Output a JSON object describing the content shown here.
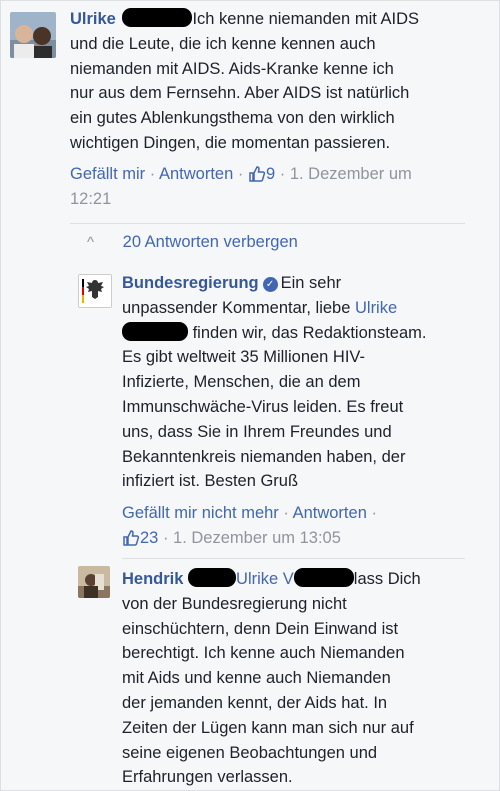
{
  "comments": [
    {
      "author": "Ulrike",
      "lines": [
        "Ich kenne niemanden mit AIDS",
        "und die Leute, die ich kenne kennen auch",
        "niemanden mit AIDS. Aids-Kranke kenne ich",
        "nur aus dem Fernsehn. Aber AIDS ist natürlich",
        "ein gutes Ablenkungsthema von den wirklich",
        "wichtigen Dingen, die momentan passieren."
      ],
      "like_label": "Gefällt mir",
      "reply_label": "Antworten",
      "likes": "9",
      "timestamp_line1": "1. Dezember um",
      "timestamp_line2": "12:21"
    }
  ],
  "replies_toggle": {
    "chevron": "^",
    "label": "20 Antworten verbergen"
  },
  "replies": [
    {
      "author": "Bundesregierung",
      "verified_icon": "verified-badge-icon",
      "first_line": "Ein sehr",
      "line2_prefix": "unpassender Kommentar, liebe ",
      "line2_link": "Ulrike",
      "line3_suffix": " finden wir, das Redaktionsteam.",
      "lines": [
        "Es gibt weltweit 35 Millionen HIV-",
        "Infizierte, Menschen, die an dem",
        "Immunschwäche-Virus leiden. Es freut",
        "uns, dass Sie in Ihrem Freundes und",
        "Bekanntenkreis niemanden haben, der",
        "infiziert ist. Besten Gruß"
      ],
      "like_label": "Gefällt mir nicht mehr",
      "reply_label": "Antworten",
      "likes": "23",
      "timestamp": "1. Dezember um 13:05"
    },
    {
      "author": "Hendrik",
      "line1_mid": "Ulrike V",
      "line1_end": "lass Dich",
      "lines": [
        "von der Bundesregierung nicht",
        "einschüchtern, denn Dein Einwand ist",
        "berechtigt. Ich kenne auch Niemanden",
        "mit Aids und kenne auch Niemanden",
        "der jemanden kennt, der Aids hat. In",
        "Zeiten der Lügen kann man sich nur auf",
        "seine eigenen Beobachtungen und",
        "Erfahrungen verlassen."
      ]
    }
  ],
  "separator": "·",
  "colors": {
    "link": "#4267b2",
    "name": "#365899",
    "meta": "#90949c",
    "background": "#f6f7f9"
  }
}
